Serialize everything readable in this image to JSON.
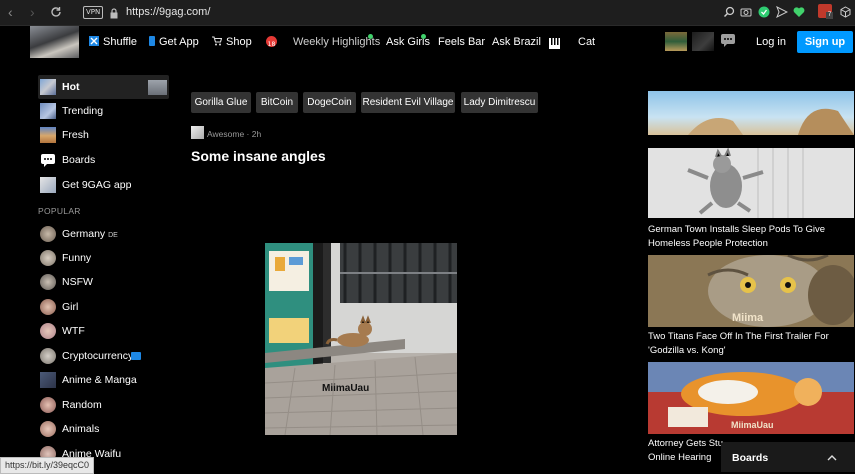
{
  "browser": {
    "vpn_label": "VPN",
    "url": "https://9gag.com/",
    "badge_count": "7"
  },
  "header": {
    "nav": [
      {
        "label": "Shuffle"
      },
      {
        "label": "Get App"
      },
      {
        "label": "Shop"
      },
      {
        "label": "Weekly Highlights"
      },
      {
        "label": "Ask Girls"
      },
      {
        "label": "Feels Bar"
      },
      {
        "label": "Ask Brazil"
      },
      {
        "label": "Cat"
      }
    ],
    "login_label": "Log in",
    "signup_label": "Sign up",
    "accent_color": "#0099ff"
  },
  "sidebar": {
    "main": [
      {
        "label": "Hot"
      },
      {
        "label": "Trending"
      },
      {
        "label": "Fresh"
      },
      {
        "label": "Boards"
      },
      {
        "label": "Get 9GAG app"
      }
    ],
    "popular_heading": "POPULAR",
    "popular": [
      {
        "label": "Germany",
        "suffix": "DE"
      },
      {
        "label": "Funny"
      },
      {
        "label": "NSFW"
      },
      {
        "label": "Girl"
      },
      {
        "label": "WTF"
      },
      {
        "label": "Cryptocurrency"
      },
      {
        "label": "Anime & Manga"
      },
      {
        "label": "Random"
      },
      {
        "label": "Animals"
      },
      {
        "label": "Anime Waifu"
      }
    ]
  },
  "tags": [
    {
      "label": "Gorilla Glue"
    },
    {
      "label": "BitCoin"
    },
    {
      "label": "DogeCoin"
    },
    {
      "label": "Resident Evil Village"
    },
    {
      "label": "Lady Dimitrescu"
    }
  ],
  "post": {
    "section": "Awesome",
    "age": "2h",
    "meta": "Awesome · 2h",
    "title": "Some insane angles",
    "watermark": "MiimaUau"
  },
  "right_column": [
    {
      "caption": ""
    },
    {
      "caption_line1": "German Town Installs Sleep Pods To Give",
      "caption_line2": "Homeless People Protection"
    },
    {
      "caption_line1": "Two Titans Face Off In The First Trailer For",
      "caption_line2": "'Godzilla vs. Kong'",
      "overlay": "Miima"
    },
    {
      "caption_line1": "Attorney Gets Stu",
      "caption_line2": "Online Hearing",
      "overlay": "MiimaUau"
    }
  ],
  "boards_panel": {
    "label": "Boards"
  },
  "status_bar": {
    "url": "https://bit.ly/39eqcC0"
  }
}
